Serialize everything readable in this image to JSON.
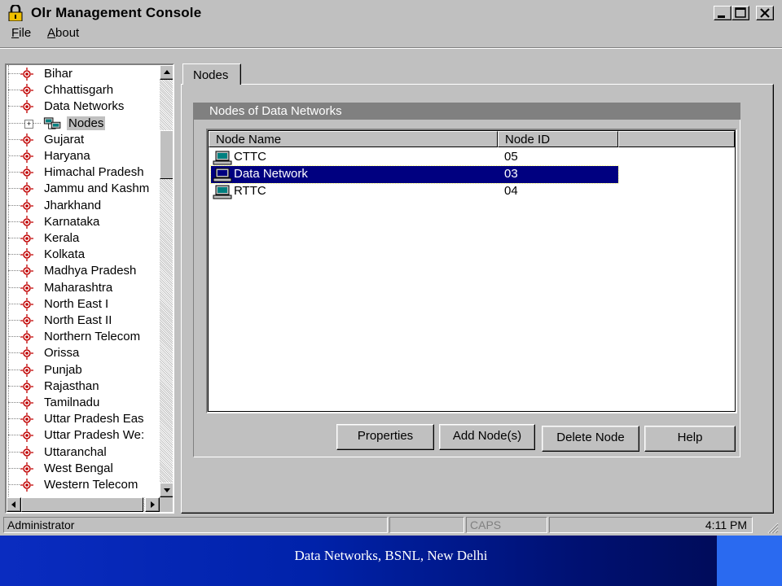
{
  "window": {
    "title": "Olr Management Console"
  },
  "menu": {
    "file_prefix": "",
    "file_underlined": "F",
    "file_rest": "ile",
    "about_underlined": "A",
    "about_rest": "bout"
  },
  "tree": {
    "items": [
      "Bihar",
      "Chhattisgarh",
      "Data Networks",
      "Nodes",
      "Gujarat",
      "Haryana",
      "Himachal Pradesh",
      "Jammu and Kashm",
      "Jharkhand",
      "Karnataka",
      "Kerala",
      "Kolkata",
      "Madhya Pradesh",
      "Maharashtra",
      "North East I",
      "North East II",
      "Northern Telecom",
      "Orissa",
      "Punjab",
      "Rajasthan",
      "Tamilnadu",
      "Uttar Pradesh Eas",
      "Uttar Pradesh We:",
      "Uttaranchal",
      "West Bengal",
      "Western Telecom"
    ],
    "expand_symbol": "+"
  },
  "tab": {
    "label": "Nodes"
  },
  "group": {
    "title": "Nodes of Data Networks"
  },
  "list": {
    "columns": [
      "Node Name",
      "Node ID"
    ],
    "rows": [
      {
        "name": "CTTC",
        "id": "05"
      },
      {
        "name": "Data Network",
        "id": "03"
      },
      {
        "name": "RTTC",
        "id": "04"
      }
    ]
  },
  "buttons": {
    "properties": "Properties",
    "add_node": "Add Node(s)",
    "delete_node": "Delete Node",
    "help": "Help"
  },
  "status": {
    "user": "Administrator",
    "caps": "CAPS",
    "time": "4:11 PM"
  },
  "footer": {
    "text": "Data Networks, BSNL, New Delhi"
  },
  "colors": {
    "window_bg": "#c0c0c0",
    "selection": "#000080",
    "footer_blue": "#0022aa",
    "footer_accent": "#2a6af0"
  }
}
